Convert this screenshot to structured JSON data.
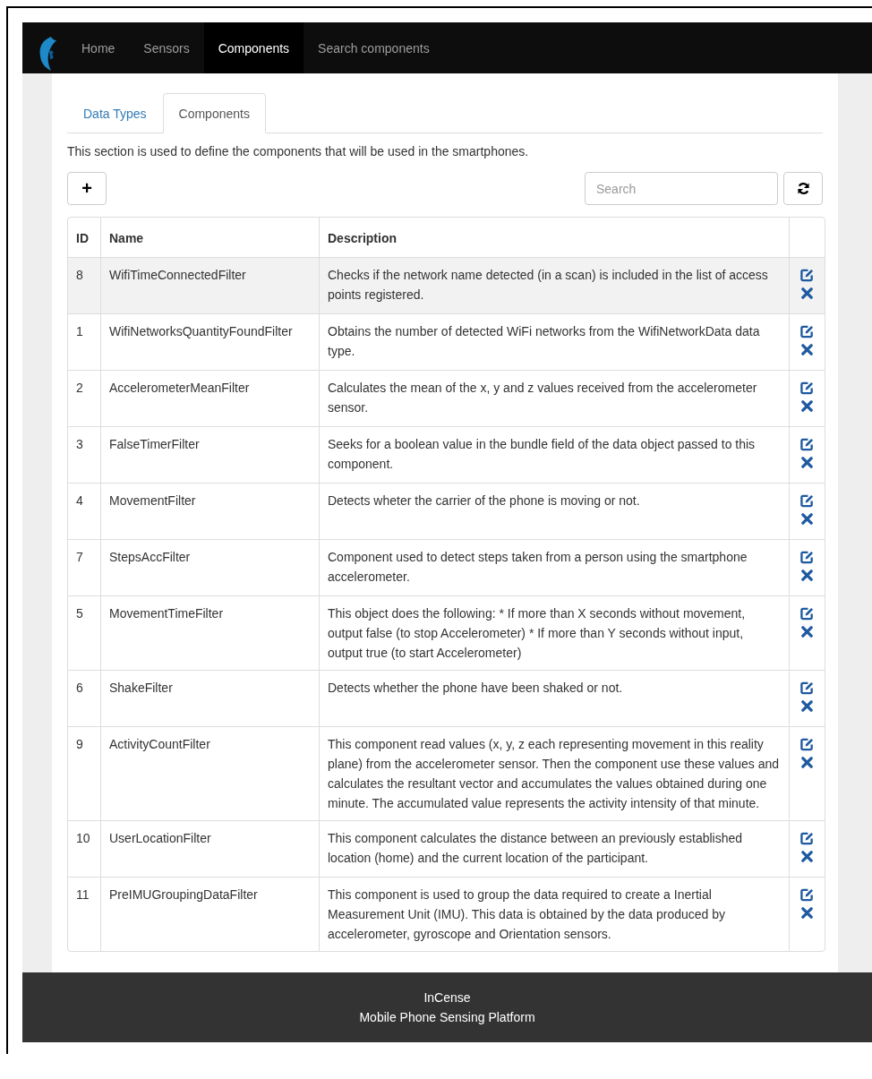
{
  "navbar": {
    "items": [
      {
        "label": "Home",
        "selected": false
      },
      {
        "label": "Sensors",
        "selected": false
      },
      {
        "label": "Components",
        "selected": true
      },
      {
        "label": "Search components",
        "selected": false
      }
    ]
  },
  "tabs": [
    {
      "label": "Data Types",
      "selected": false
    },
    {
      "label": "Components",
      "selected": true
    }
  ],
  "intro": "This section is used to define the components that will be used in the smartphones.",
  "toolbar": {
    "add_button": "+",
    "search": {
      "placeholder": "Search"
    }
  },
  "table": {
    "columns": [
      "ID",
      "Name",
      "Description"
    ],
    "rows": [
      {
        "id": "8",
        "name": "WifiTimeConnectedFilter",
        "description": "Checks if the network name detected (in a scan) is included in the list of access points registered.",
        "highlighted": true
      },
      {
        "id": "1",
        "name": "WifiNetworksQuantityFoundFilter",
        "description": "Obtains the number of detected WiFi networks from the WifiNetworkData data type.",
        "highlighted": false
      },
      {
        "id": "2",
        "name": "AccelerometerMeanFilter",
        "description": "Calculates the mean of the x, y and z values received from the accelerometer sensor.",
        "highlighted": false
      },
      {
        "id": "3",
        "name": "FalseTimerFilter",
        "description": "Seeks for a boolean value in the bundle field of the data object passed to this component.",
        "highlighted": false
      },
      {
        "id": "4",
        "name": "MovementFilter",
        "description": "Detects wheter the carrier of the phone is moving or not.",
        "highlighted": false
      },
      {
        "id": "7",
        "name": "StepsAccFilter",
        "description": "Component used to detect steps taken from a person using the smartphone accelerometer.",
        "highlighted": false
      },
      {
        "id": "5",
        "name": "MovementTimeFilter",
        "description": "This object does the following: * If more than X seconds without movement, output false (to stop Accelerometer) * If more than Y seconds without input, output true (to start Accelerometer)",
        "highlighted": false
      },
      {
        "id": "6",
        "name": "ShakeFilter",
        "description": "Detects whether the phone have been shaked or not.",
        "highlighted": false
      },
      {
        "id": "9",
        "name": "ActivityCountFilter",
        "description": "This component read values (x, y, z each representing movement in this reality plane) from the accelerometer sensor. Then the component use these values and calculates the resultant vector and accumulates the values obtained during one minute. The accumulated value represents the activity intensity of that minute.",
        "highlighted": false
      },
      {
        "id": "10",
        "name": "UserLocationFilter",
        "description": "This component calculates the distance between an previously established location (home) and the current location of the participant.",
        "highlighted": false
      },
      {
        "id": "11",
        "name": "PreIMUGroupingDataFilter",
        "description": "This component is used to group the data required to create a Inertial Measurement Unit (IMU). This data is obtained by the data produced by accelerometer, gyroscope and Orientation sensors.",
        "highlighted": false
      }
    ]
  },
  "footer": {
    "title": "InCense",
    "subtitle": "Mobile Phone Sensing Platform"
  }
}
